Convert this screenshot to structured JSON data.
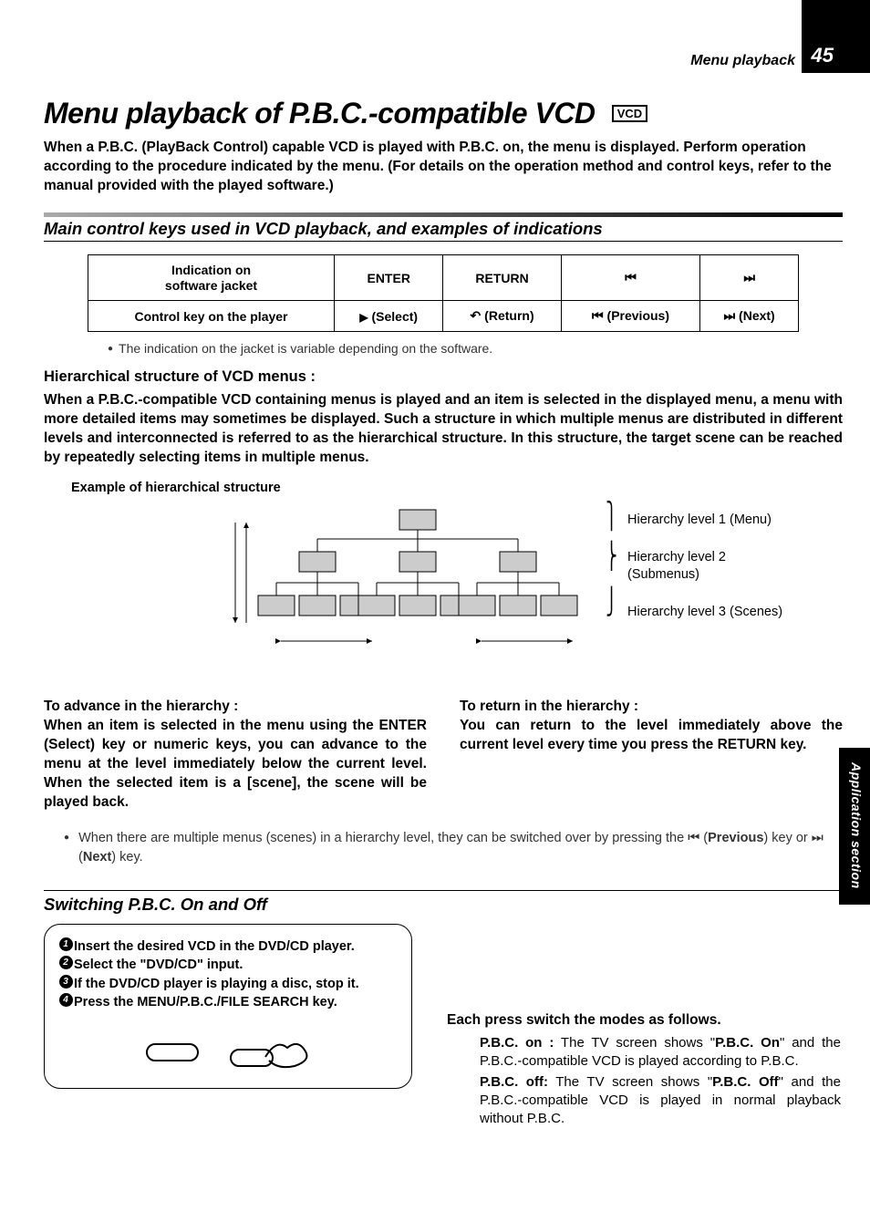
{
  "page": {
    "number": "45",
    "breadcrumb": "Menu playback",
    "side_tab": "Application section"
  },
  "title": "Menu playback of P.B.C.-compatible VCD",
  "badge": "VCD",
  "intro": "When a P.B.C. (PlayBack Control) capable VCD is played with P.B.C. on, the menu is displayed. Perform operation according to the procedure indicated by the menu. (For details on the operation method and control keys, refer to the manual provided with the played software.)",
  "section1_title": "Main control keys used in VCD playback, and examples of indications",
  "table": {
    "r1c1a": "Indication on",
    "r1c1b": "software jacket",
    "r1c2": "ENTER",
    "r1c3": "RETURN",
    "r2c1": "Control key on the player",
    "r2c2": "(Select)",
    "r2c3": "(Return)",
    "r2c4": "(Previous)",
    "r2c5": "(Next)"
  },
  "table_note": "The indication on the jacket is variable depending on the software.",
  "hier_title": "Hierarchical structure of VCD menus :",
  "hier_para": "When a P.B.C.-compatible VCD containing menus is played and an item is selected in the displayed menu, a menu with more detailed items may sometimes be displayed. Such a structure in which multiple menus are distributed in different levels and interconnected is referred to as the hierarchical structure. In this structure, the target scene can be reached by repeatedly selecting items in multiple menus.",
  "example_label": "Example of hierarchical structure",
  "hier_levels": {
    "l1": "Hierarchy level 1 (Menu)",
    "l2a": "Hierarchy level 2",
    "l2b": "(Submenus)",
    "l3": "Hierarchy level 3 (Scenes)"
  },
  "advance_title": "To advance in the hierarchy :",
  "advance_body": "When an item is selected in the menu using the ENTER (Select)  key or numeric keys, you can advance to the menu at the level immediately below the current level. When the selected item is a [scene], the scene will be played back.",
  "return_title": "To return in the hierarchy :",
  "return_body": "You can return to the level immediately above the current level every time you press the RETURN key.",
  "multi_note_a": "When there are multiple menus (scenes) in a hierarchy level, they can be switched over by pressing the ",
  "multi_note_prev": "Previous",
  "multi_note_b": " key or ",
  "multi_note_next": "Next",
  "multi_note_c": ") key.",
  "switch_title": "Switching P.B.C. On and Off",
  "steps": {
    "s1": "Insert the desired VCD in the DVD/CD player.",
    "s2": "Select the \"DVD/CD\" input.",
    "s3": "If the DVD/CD player is playing a disc, stop it.",
    "s4": "Press the MENU/P.B.C./FILE SEARCH key."
  },
  "modes": {
    "lead": "Each press switch the modes as follows.",
    "on_label": "P.B.C. on :",
    "on_body_a": " The TV screen shows \"",
    "on_bold": "P.B.C. On",
    "on_body_b": "\" and the P.B.C.-compatible VCD is played according to P.B.C.",
    "off_label": "P.B.C. off:",
    "off_body_a": " The TV screen shows \"",
    "off_bold": "P.B.C. Off",
    "off_body_b": "\" and the P.B.C.-compatible VCD is played in normal playback without P.B.C."
  }
}
